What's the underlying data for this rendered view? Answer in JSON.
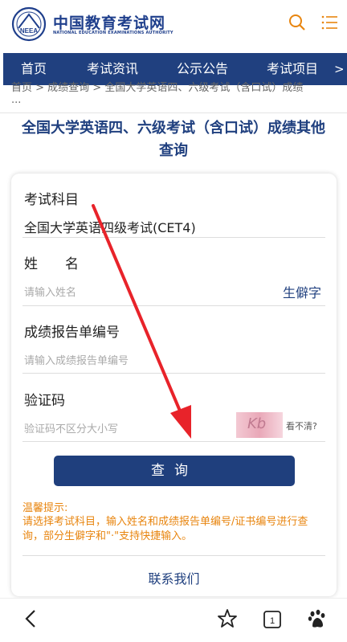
{
  "header": {
    "logo_cn": "中国教育考试网",
    "logo_en": "NATIONAL EDUCATION EXAMINATIONS AUTHORITY",
    "emblem_text": "NEEA",
    "search_icon": "search-icon",
    "menu_icon": "menu-icon"
  },
  "nav": {
    "items": [
      "首页",
      "考试资讯",
      "公示公告",
      "考试项目"
    ],
    "more": ">"
  },
  "breadcrumb": {
    "text": "首页 > 成绩查询 > 全国大学英语四、六级考试（含口试）成绩",
    "more": "..."
  },
  "page_title": "全国大学英语四、六级考试（含口试）成绩其他查询",
  "form": {
    "subject_label": "考试科目",
    "subject_value": "全国大学英语四级考试(CET4)",
    "name_label": "姓　　名",
    "name_placeholder": "请输入姓名",
    "rare_char": "生僻字",
    "report_label": "成绩报告单编号",
    "report_placeholder": "请输入成绩报告单编号",
    "captcha_label": "验证码",
    "captcha_placeholder": "验证码不区分大小写",
    "captcha_image_text": "Kb",
    "unclear": "看不清?",
    "query_button": "查询",
    "tip_title": "温馨提示:",
    "tip_body": "请选择考试科目，输入姓名和成绩报告单编号/证书编号进行查询，部分生僻字和\"·\"支持快捷输入。",
    "contact": "联系我们"
  },
  "bottom_bar": {
    "icons": [
      "back-icon",
      "star-icon",
      "page-icon",
      "baidu-icon"
    ],
    "page_count": "1"
  },
  "colors": {
    "brand_blue": "#20407f",
    "tip_orange": "#e8850f",
    "arrow_red": "#e8232a"
  }
}
